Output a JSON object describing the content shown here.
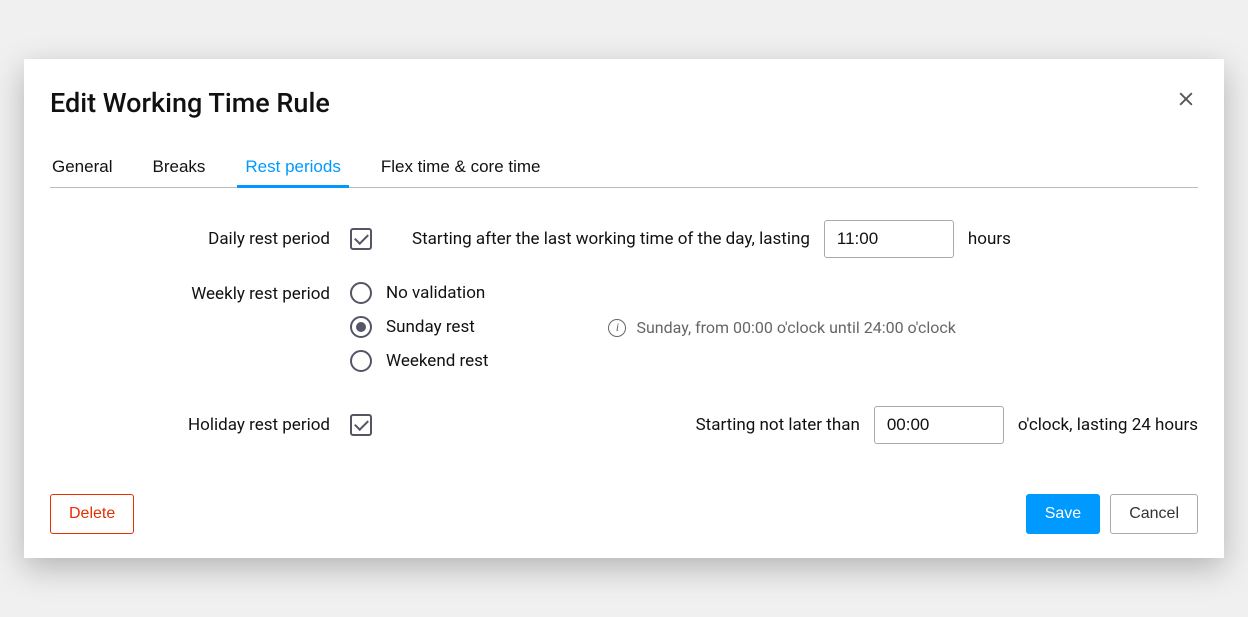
{
  "title": "Edit Working Time Rule",
  "tabs": {
    "general": "General",
    "breaks": "Breaks",
    "rest_periods": "Rest periods",
    "flex_time": "Flex time & core time"
  },
  "daily": {
    "label": "Daily rest period",
    "checked": true,
    "text_pre": "Starting after the last working time of the day, lasting",
    "value": "11:00",
    "text_post": "hours"
  },
  "weekly": {
    "label": "Weekly rest period",
    "options": {
      "no_validation": "No validation",
      "sunday_rest": "Sunday rest",
      "weekend_rest": "Weekend rest"
    },
    "selected": "sunday_rest",
    "info_text": "Sunday, from 00:00 o'clock until 24:00 o'clock"
  },
  "holiday": {
    "label": "Holiday rest period",
    "checked": true,
    "text_pre": "Starting not later than",
    "value": "00:00",
    "text_post": "o'clock, lasting 24 hours"
  },
  "buttons": {
    "delete": "Delete",
    "save": "Save",
    "cancel": "Cancel"
  }
}
